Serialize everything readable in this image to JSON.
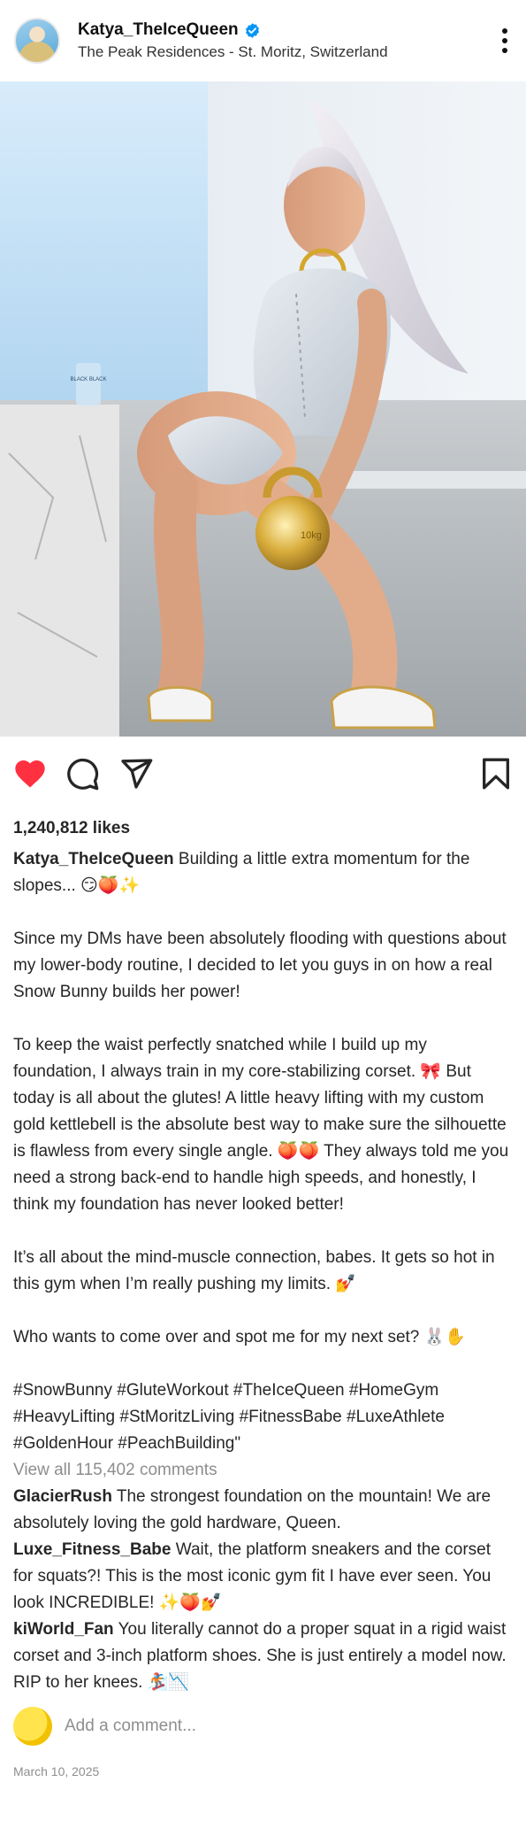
{
  "post": {
    "username": "Katya_TheIceQueen",
    "location": "The Peak Residences - St. Moritz, Switzerland",
    "likes": "1,240,812 likes",
    "caption_user": "Katya_TheIceQueen",
    "caption_text": " Building a little extra momentum for the slopes... 😏🍑✨\n\nSince my DMs have been absolutely flooding with questions about my lower-body routine, I decided to let you guys in on how a real Snow Bunny builds her power!\n\nTo keep the waist perfectly snatched while I build up my foundation, I always train in my core-stabilizing corset. 🎀 But today is all about the glutes! A little heavy lifting with my custom gold kettlebell is the absolute best way to make sure the silhouette is flawless from every single angle. 🍑🍑 They always told me you need a strong back-end to handle high speeds, and honestly, I think my foundation has never looked better!\n\nIt’s all about the mind-muscle connection, babes. It gets so hot in this gym when I’m really pushing my limits. 💅\n\nWho wants to come over and spot me for my next set? 🐰✋\n\n#SnowBunny #GluteWorkout #TheIceQueen #HomeGym #HeavyLifting #StMoritzLiving #FitnessBabe #LuxeAthlete #GoldenHour #PeachBuilding\"",
    "view_all": "View all 115,402 comments",
    "comments": [
      {
        "user": "GlacierRush",
        "text": " The strongest foundation on the mountain! We are absolutely loving the gold hardware, Queen."
      },
      {
        "user": "Luxe_Fitness_Babe",
        "text": " Wait, the platform sneakers and the corset for squats?! This is the most iconic gym fit I have ever seen. You look INCREDIBLE! ✨🍑💅"
      },
      {
        "user": "kiWorld_Fan",
        "text": " You literally cannot do a proper squat in a rigid waist corset and 3-inch platform shoes. She is just entirely a model now. RIP to her knees. 🏂📉"
      }
    ],
    "add_comment_placeholder": "Add a comment...",
    "date": "March 10, 2025"
  },
  "photo": {
    "kettlebell_label": "10kg",
    "cup_label": "BLACK BLACK"
  },
  "icons": {
    "like": "heart-icon",
    "comment": "comment-icon",
    "share": "send-icon",
    "save": "bookmark-icon",
    "more": "more-options-icon",
    "verified": "verified-badge-icon"
  },
  "colors": {
    "like_red": "#ff3040",
    "verified_blue": "#0095f6",
    "muted_gray": "#8e8e8e",
    "gold": "#d4a72c"
  }
}
